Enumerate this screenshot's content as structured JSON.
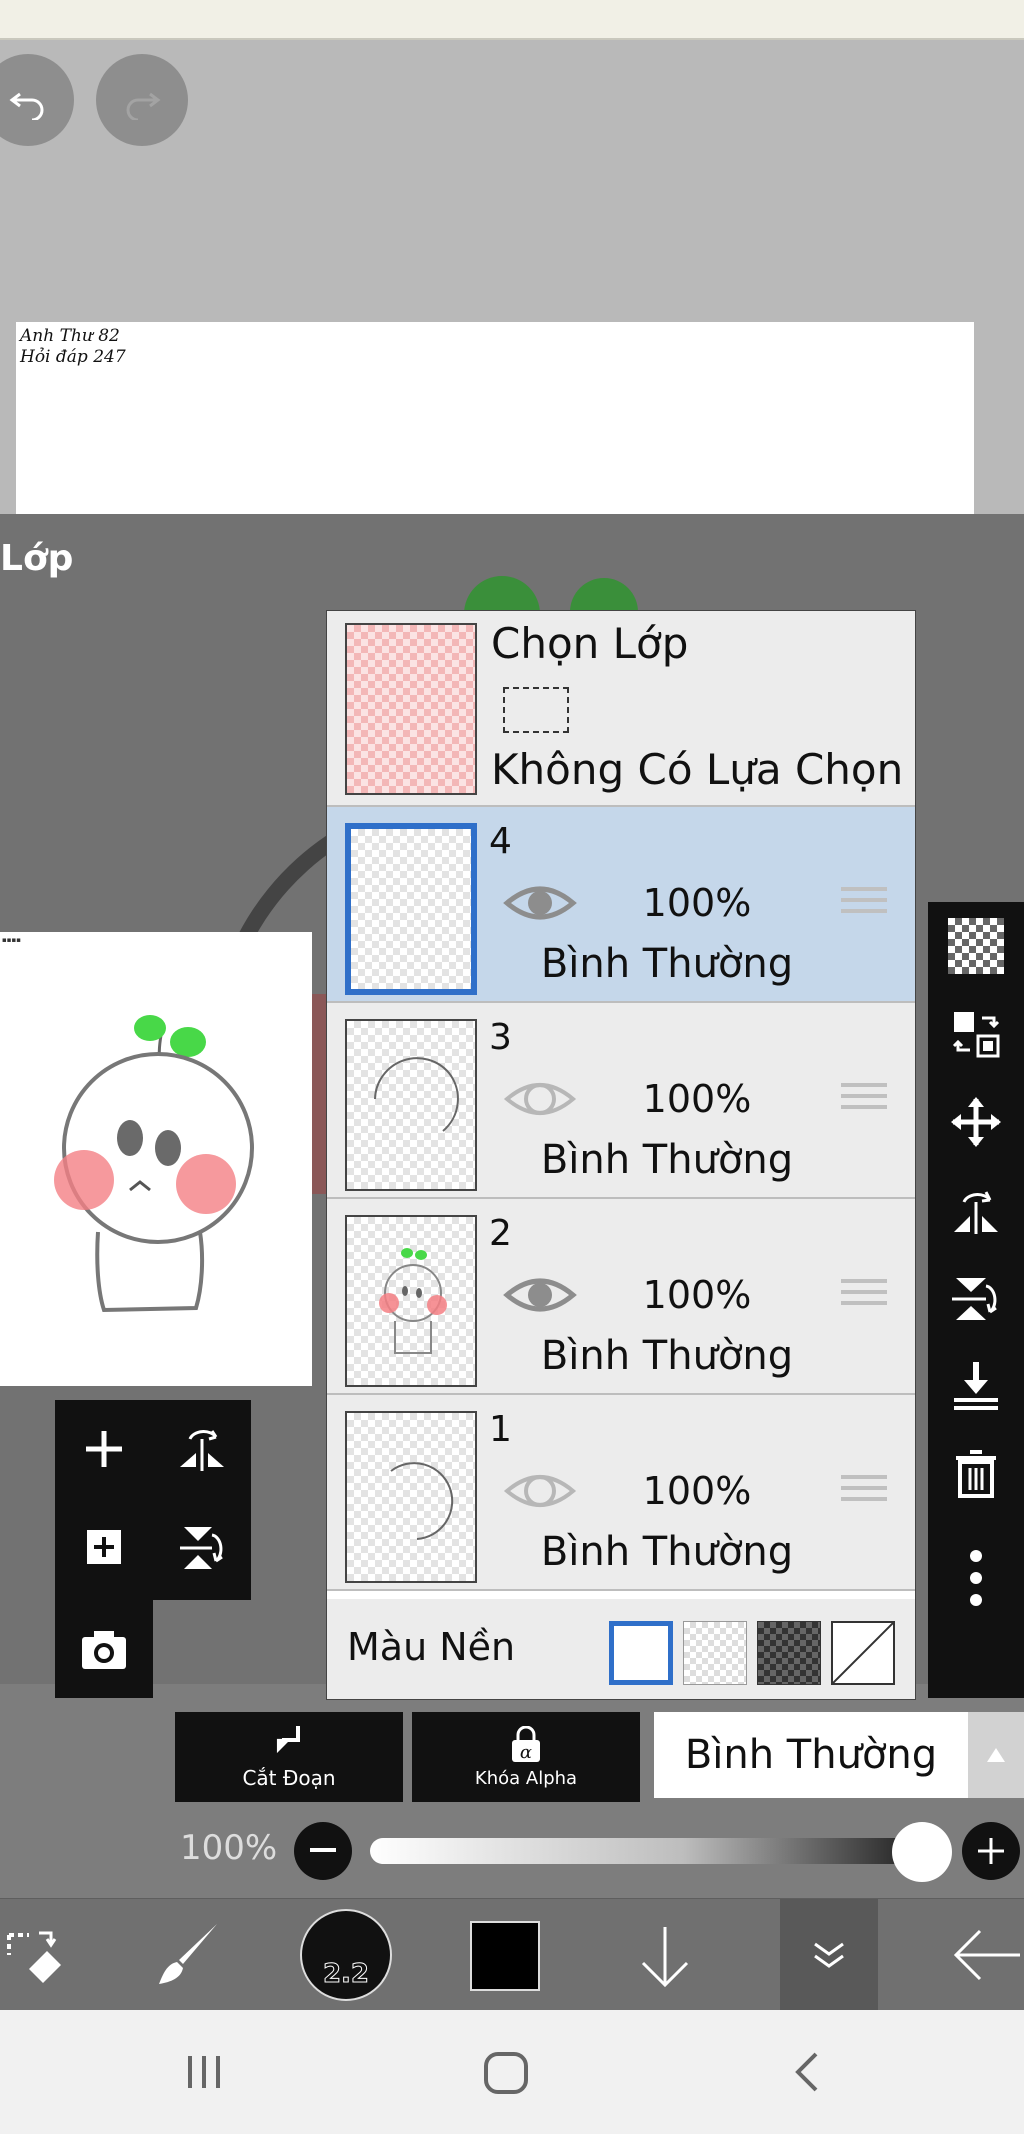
{
  "canvas": {
    "handwriting": [
      "Anh Thư 82",
      "Hỏi đáp 247"
    ],
    "undo_icon": "undo-icon",
    "redo_icon": "redo-icon"
  },
  "layer_panel_title": "Lớp",
  "selection_row": {
    "title": "Chọn Lớp",
    "status": "Không Có Lựa Chọn"
  },
  "layers": [
    {
      "number": "4",
      "opacity": "100%",
      "blend": "Bình Thường",
      "visible": true,
      "selected": true
    },
    {
      "number": "3",
      "opacity": "100%",
      "blend": "Bình Thường",
      "visible": true,
      "selected": false
    },
    {
      "number": "2",
      "opacity": "100%",
      "blend": "Bình Thường",
      "visible": true,
      "selected": false
    },
    {
      "number": "1",
      "opacity": "100%",
      "blend": "Bình Thường",
      "visible": true,
      "selected": false
    }
  ],
  "background": {
    "label": "Màu Nền",
    "options": [
      "white",
      "transparent",
      "dark-checker",
      "none"
    ],
    "selected": "white"
  },
  "layer_actions": {
    "clip": "Cắt Đoạn",
    "alpha_lock": "Khóa Alpha",
    "blend_mode": "Bình Thường"
  },
  "opacity": {
    "label": "100%",
    "value": 1.0
  },
  "brush_size": "2.2",
  "colors": {
    "selection": "#2f6fc9",
    "selected_row": "#c5d7ea",
    "leaf_green": "#48d848",
    "cheek_pink": "#f47f84"
  }
}
